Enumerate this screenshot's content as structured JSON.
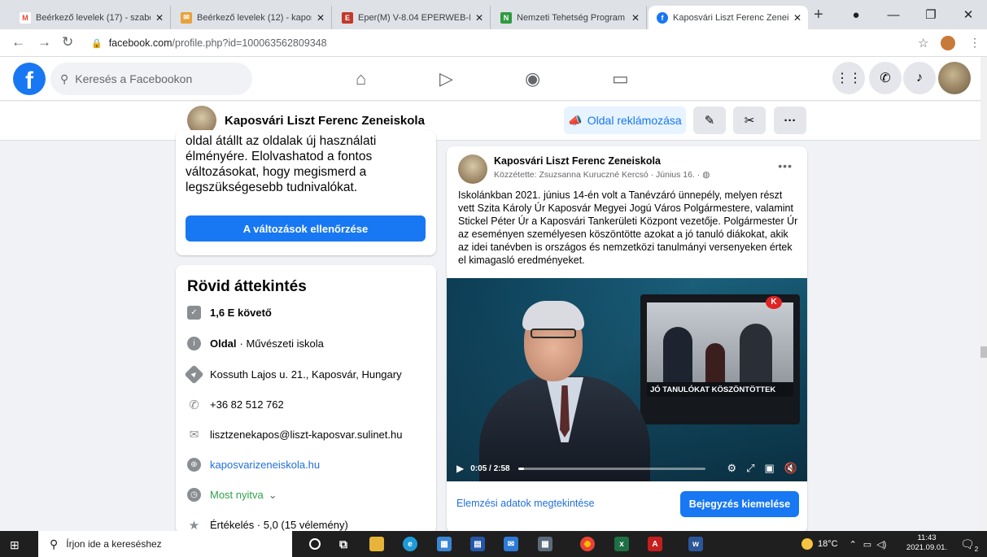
{
  "browser": {
    "tabs": [
      {
        "title": "Beérkező levelek (17) - szabo",
        "icon": "gmail-icon",
        "color": "#ea4335",
        "glyph": "M"
      },
      {
        "title": "Beérkező levelek (12) - kapos",
        "icon": "mail-icon",
        "color": "#e8a13a",
        "glyph": "✉"
      },
      {
        "title": "Eper(M) V-8.04 EPERWEB-I :",
        "icon": "eper-icon",
        "color": "#c0392b",
        "glyph": "E"
      },
      {
        "title": "Nemzeti Tehetség Program –",
        "icon": "ntp-icon",
        "color": "#2e9b3f",
        "glyph": "N"
      },
      {
        "title": "Kaposvári Liszt Ferenc Zeneis",
        "icon": "facebook-icon",
        "color": "#1877f2",
        "glyph": "f"
      }
    ],
    "new_tab": "+",
    "url_host": "facebook.com",
    "url_path": "/profile.php?id=100063562809348"
  },
  "fb_header": {
    "logo": "f",
    "search_placeholder": "Keresés a Facebookon",
    "nav_icons": [
      "home-icon",
      "watch-icon",
      "groups-icon",
      "gaming-icon"
    ]
  },
  "page_header": {
    "name": "Kaposvári Liszt Ferenc Zeneiskola",
    "promote_label": "Oldal reklámozása"
  },
  "notice": {
    "text": "oldal átállt az oldalak új használati élményére. Elolvashatod a fontos változásokat, hogy megismerd a legszükségesebb tudnivalókat.",
    "button": "A változások ellenőrzése"
  },
  "about": {
    "title": "Rövid áttekintés",
    "followers": "1,6 E követő",
    "page_label": "Oldal",
    "category": "· Művészeti iskola",
    "address": "Kossuth Lajos u. 21., Kaposvár, Hungary",
    "phone": "+36 82 512 762",
    "email": "lisztzenekapos@liszt-kaposvar.sulinet.hu",
    "website": "kaposvarizeneiskola.hu",
    "open": "Most nyitva",
    "open_caret": "⌄",
    "rating": "Értékelés · 5,0 (15 vélemény)"
  },
  "post": {
    "author": "Kaposvári Liszt Ferenc Zeneiskola",
    "meta": "Közzétette: Zsuzsanna Kuruczné Kercsó  · Június 16. ·",
    "text": "Iskolánkban 2021. június 14-én volt a Tanévzáró ünnepély, melyen részt vett Szita Károly Úr Kaposvár Megyei Jogú Város Polgármestere, valamint Stickel Péter Úr a Kaposvári Tankerületi Központ vezetője. Polgármester Úr az eseményen személyesen köszöntötte azokat a jó tanuló diákokat, akik az idei tanévben is országos és nemzetközi tanulmányi versenyeken értek el kimagasló eredményeket.",
    "video_caption": "JÓ TANULÓKAT KÖSZÖNTÖTTEK",
    "video_logo": "K",
    "video_time": "0:05 / 2:58",
    "video_progress": 0.03,
    "insights_link": "Elemzési adatok megtekintése",
    "boost_button": "Bejegyzés kiemelése"
  },
  "taskbar": {
    "search_placeholder": "Írjon ide a kereséshez",
    "temperature": "18°C",
    "time": "11:43",
    "date": "2021.09.01.",
    "notifications": "2"
  }
}
